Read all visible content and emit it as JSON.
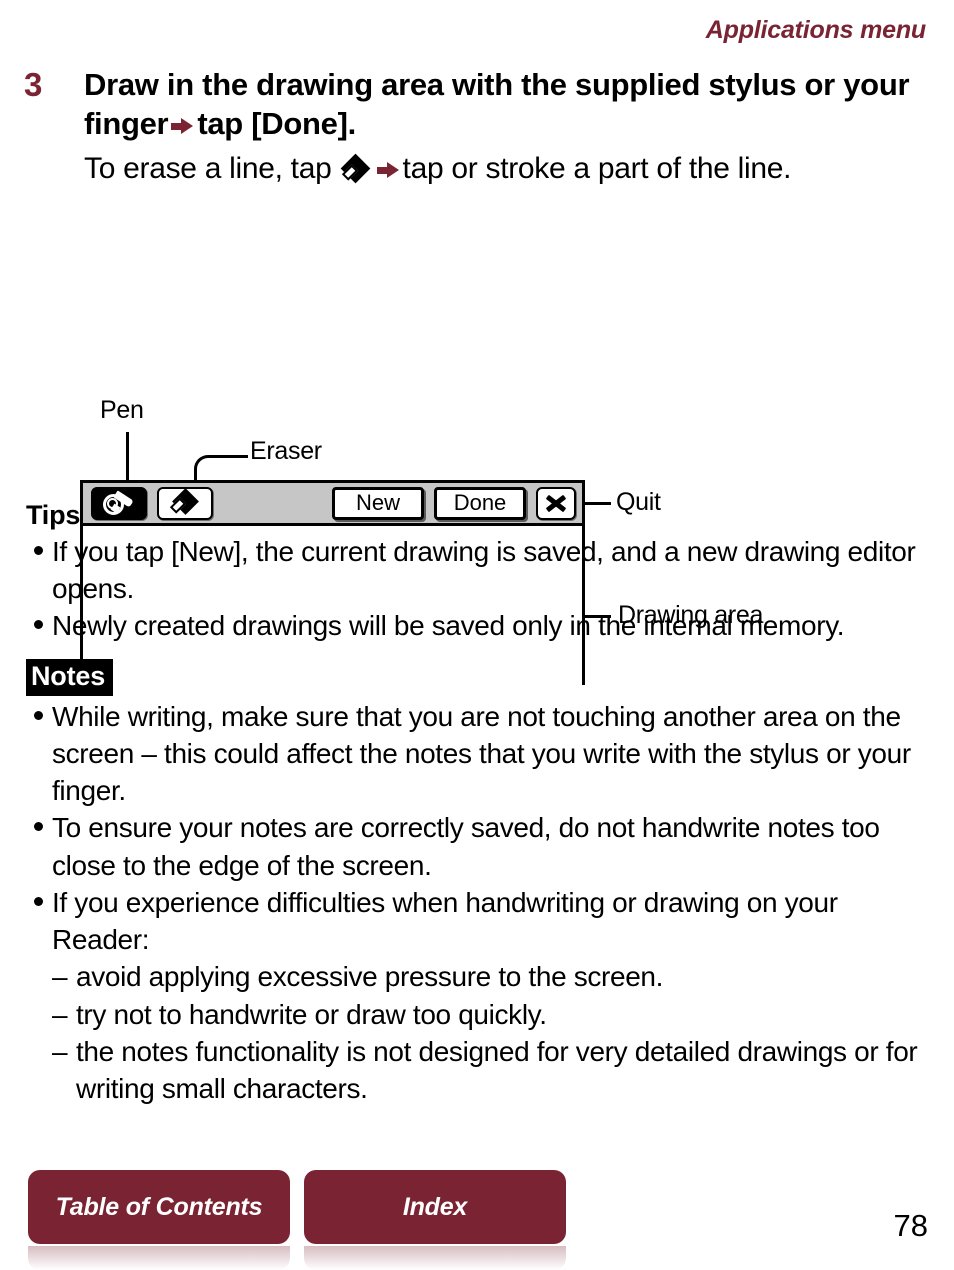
{
  "running_head": "Applications menu",
  "step": {
    "number": "3",
    "title_part1": "Draw in the drawing area with the supplied stylus or your finger",
    "title_arrow": "arrow-right-icon",
    "title_part2": "tap [Done].",
    "sub_part1": "To erase a line, tap",
    "sub_eraser_glyph": "eraser-diamond-icon",
    "sub_arrow": "arrow-right-icon",
    "sub_part2": "tap or stroke a part of the line."
  },
  "figure": {
    "callouts": {
      "pen": "Pen",
      "eraser": "Eraser",
      "quit": "Quit",
      "drawing_area": "Drawing area"
    },
    "device": {
      "toolbar": {
        "pen_tool": {
          "name": "pen-tool",
          "icon": "pen-icon",
          "selected": true
        },
        "eraser_tool": {
          "name": "eraser-tool",
          "icon": "eraser-icon",
          "selected": false
        },
        "new_button": "New",
        "done_button": "Done",
        "quit_button_icon": "close-icon"
      },
      "canvas_label": "Drawing area"
    }
  },
  "tips": {
    "heading": "Tips",
    "items": [
      "If you tap [New], the current drawing is saved, and a new drawing editor opens.",
      "Newly created drawings will be saved only in the internal memory."
    ]
  },
  "notes": {
    "heading": "Notes",
    "items": [
      "While writing, make sure that you are not touching another area on the screen – this could affect the notes that you write with the stylus or your finger.",
      "To ensure your notes are correctly saved, do not handwrite notes too close to the edge of the screen.",
      "If you experience difficulties when handwriting or drawing on your Reader:"
    ],
    "sub_items": [
      "avoid applying excessive pressure to the screen.",
      "try not to handwrite or draw too quickly.",
      "the notes functionality is not designed for very detailed drawings or for writing small characters."
    ]
  },
  "footer": {
    "table_of_contents": "Table of Contents",
    "index": "Index",
    "page_number": "78"
  },
  "colors": {
    "accent_maroon": "#7a2433",
    "toolbar_gray": "#c6c6c6",
    "text_black": "#000000"
  }
}
